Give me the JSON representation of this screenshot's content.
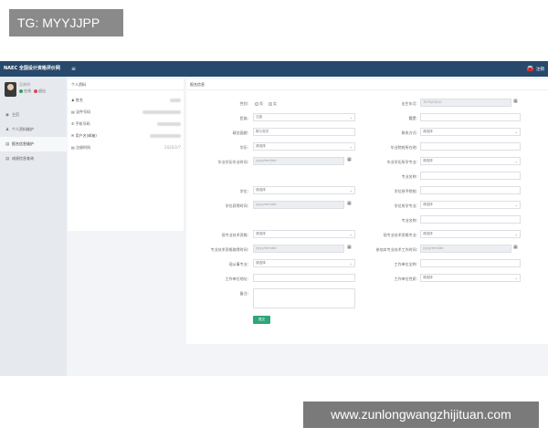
{
  "overlay": {
    "tg_label": "TG: MYYJJPP",
    "watermark": "www.zunlongwangzhijituan.com"
  },
  "topbar": {
    "brand": "NAEC 全国设计资格评价网",
    "menu_icon": "menu-icon",
    "user_icon": "car-icon",
    "user_label": "注销"
  },
  "sidebar": {
    "user_name": "吴晓明",
    "status_online": "在线",
    "status_logout": "退出",
    "items": [
      {
        "icon": "home-icon",
        "glyph": "◉",
        "label": "主页"
      },
      {
        "icon": "person-icon",
        "glyph": "♟",
        "label": "个人资料维护"
      },
      {
        "icon": "form-icon",
        "glyph": "▤",
        "label": "报名信息维护"
      },
      {
        "icon": "score-icon",
        "glyph": "▤",
        "label": "成绩信息查询"
      }
    ]
  },
  "profile_card": {
    "title": "个人资料",
    "rows": [
      {
        "icon": "♟",
        "label": "姓名"
      },
      {
        "icon": "▤",
        "label": "证件号码"
      },
      {
        "icon": "✆",
        "label": "手机号码"
      },
      {
        "icon": "✉",
        "label": "用户名(邮箱)"
      },
      {
        "icon": "▤",
        "label": "注册时间",
        "value": "2020/2/7"
      }
    ]
  },
  "form": {
    "title": "报名信息",
    "fields": {
      "gender": {
        "label": "性别:",
        "options": [
          "男",
          "女"
        ]
      },
      "birth_date": {
        "label": "出生年月:",
        "value": "1970/03/10"
      },
      "ethnicity": {
        "label": "民族:",
        "value": "汉族"
      },
      "native_place": {
        "label": "籍贯:"
      },
      "political": {
        "label": "政治面貌:",
        "value": "群众党员"
      },
      "contact": {
        "label": "联系方式:",
        "value": "请选择"
      },
      "education": {
        "label": "学历:",
        "value": "请选择"
      },
      "school_location": {
        "label": "毕业院校所在地:"
      },
      "grad_date": {
        "label": "毕业学历毕业时间:",
        "value": "yyyy/mm/dd"
      },
      "edu_major": {
        "label": "毕业学历所学专业:",
        "value": "请选择"
      },
      "degree": {
        "label": "学位:",
        "value": "请选择"
      },
      "degree_major_name": {
        "label": "专业名称:"
      },
      "degree_school": {
        "label": "学位授予院校:"
      },
      "degree_date": {
        "label": "学位获得时间:",
        "value": "yyyy/mm/dd"
      },
      "degree_major": {
        "label": "学位所学专业:",
        "value": "请选择"
      },
      "degree_major_name2": {
        "label": "专业名称:"
      },
      "current_title": {
        "label": "现专业技术资格:",
        "value": "请选择"
      },
      "current_specialty": {
        "label": "现专业技术资格专业:",
        "value": "请选择"
      },
      "title_date": {
        "label": "专业技术资格取得时间:",
        "value": "yyyy/mm/dd"
      },
      "work_start_date": {
        "label": "参加本专业技术工作时间:",
        "value": "yyyy/mm/dd"
      },
      "work_unit_type": {
        "label": "现从事专业:",
        "value": "请选择"
      },
      "work_unit_name": {
        "label": "工作单位全称:"
      },
      "work_unit_address": {
        "label": "工作单位地址:"
      },
      "work_unit_nature": {
        "label": "工作单位性质:",
        "value": "请选择"
      },
      "remark": {
        "label": "备注:"
      }
    },
    "submit_label": "提交"
  }
}
